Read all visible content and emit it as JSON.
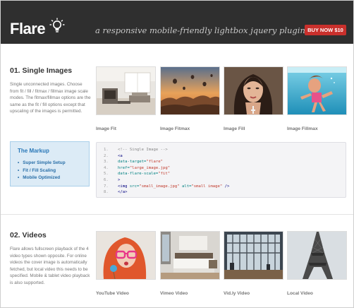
{
  "header": {
    "logo": "Flare",
    "tagline": "a responsive mobile-friendly lightbox jquery plugin.",
    "buy_button": "BUY NOW $10",
    "colors": {
      "bar": "#2f2f2f",
      "buy": "#c9302c"
    }
  },
  "images_section": {
    "title": "01. Single Images",
    "description": "Single unconnected images. Choose from fit / fill / fitmax / fillmax image scale modes. The fitmax/fillmax options are the same as the fit / fill options except that upscaling of the images is permitted.",
    "items": [
      {
        "caption": "Image Fit",
        "icon": "living-room-photo"
      },
      {
        "caption": "Image Fitmax",
        "icon": "balloons-sunset-photo"
      },
      {
        "caption": "Image Fill",
        "icon": "woman-portrait-photo"
      },
      {
        "caption": "Image Fillmax",
        "icon": "girl-underwater-photo"
      }
    ]
  },
  "markup": {
    "title": "The Markup",
    "bullets": [
      "Super Simple Setup",
      "Fit / Fill Scaling",
      "Mobile Optimized"
    ]
  },
  "code": {
    "lines": [
      {
        "n": "1.",
        "parts": [
          [
            "com",
            "<!-- Single Image -->"
          ]
        ]
      },
      {
        "n": "2.",
        "parts": [
          [
            "tag",
            "<a"
          ]
        ]
      },
      {
        "n": "3.",
        "parts": [
          [
            "attr",
            "  data-target="
          ],
          [
            "val",
            "\"flare\""
          ]
        ]
      },
      {
        "n": "4.",
        "parts": [
          [
            "attr",
            "  href="
          ],
          [
            "val",
            "\"large_image.jpg\""
          ]
        ]
      },
      {
        "n": "5.",
        "parts": [
          [
            "attr",
            "  data-flare-scale="
          ],
          [
            "val",
            "\"fit\""
          ]
        ]
      },
      {
        "n": "6.",
        "parts": [
          [
            "tag",
            "  >"
          ]
        ]
      },
      {
        "n": "7.",
        "parts": [
          [
            "tag",
            "  <img "
          ],
          [
            "attr",
            "src="
          ],
          [
            "val",
            "\"small_image.jpg\""
          ],
          [
            "attr",
            " alt="
          ],
          [
            "val",
            "\"small image\""
          ],
          [
            "tag",
            " />"
          ]
        ]
      },
      {
        "n": "8.",
        "parts": [
          [
            "tag",
            "</a>"
          ]
        ]
      }
    ]
  },
  "videos_section": {
    "title": "02. Videos",
    "description": "Flare allows fullscreen playback of the 4 video types shown opposite. For online videos the cover image is automatically fetched, but local video this needs to be specified. Mobile & tablet video playback is also supported.",
    "items": [
      {
        "caption": "YouTube Video",
        "icon": "woman-glasses-photo"
      },
      {
        "caption": "Vimeo Video",
        "icon": "bedroom-photo"
      },
      {
        "caption": "Vid.ly Video",
        "icon": "glass-hall-photo"
      },
      {
        "caption": "Local Video",
        "icon": "eiffel-tower-photo"
      }
    ]
  }
}
